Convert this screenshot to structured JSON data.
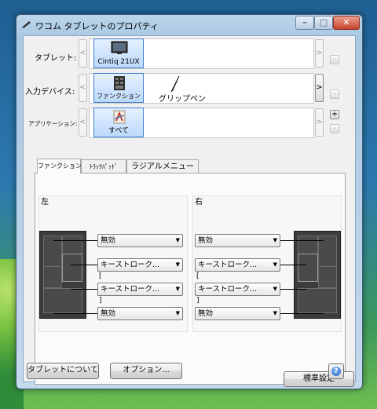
{
  "window": {
    "title": "ワコム タブレットのプロパティ"
  },
  "title_buttons": {
    "minimize": "–",
    "maximize": "□",
    "close": "✕"
  },
  "rows": {
    "tablet": {
      "label": "タブレット:",
      "items": [
        "Cintiq 21UX"
      ]
    },
    "input_device": {
      "label": "入力デバイス:",
      "items": [
        "ファンクション",
        "グリップペン"
      ]
    },
    "application": {
      "label": "アプリケーション:",
      "items": [
        "すべて"
      ]
    }
  },
  "arrows": {
    "left": "<",
    "right": ">"
  },
  "pm": {
    "minus": "-",
    "plus": "+"
  },
  "tabs": [
    "ファンクションキー",
    "ﾄﾗｯｸﾊﾟｯﾄﾞ",
    "ラジアルメニュー"
  ],
  "left_group": {
    "label": "左",
    "dropdowns": [
      "無効",
      "キーストローク...",
      "キーストローク...",
      "無効"
    ],
    "bracket_open": "[",
    "bracket_close": "]"
  },
  "right_group": {
    "label": "右",
    "dropdowns": [
      "無効",
      "キーストローク...",
      "キーストローク...",
      "無効"
    ],
    "bracket_open": "[",
    "bracket_close": "]"
  },
  "buttons": {
    "default": "標準設定",
    "about": "タブレットについて",
    "options": "オプション..."
  },
  "help": "?",
  "icons": [
    "tablet-icon",
    "pen-icon",
    "function-keys-icon",
    "all-applications-icon",
    "help-icon"
  ],
  "colors": {
    "selection": "#3c7fd1",
    "help": "#2d66c4",
    "close": "#c8442e"
  }
}
